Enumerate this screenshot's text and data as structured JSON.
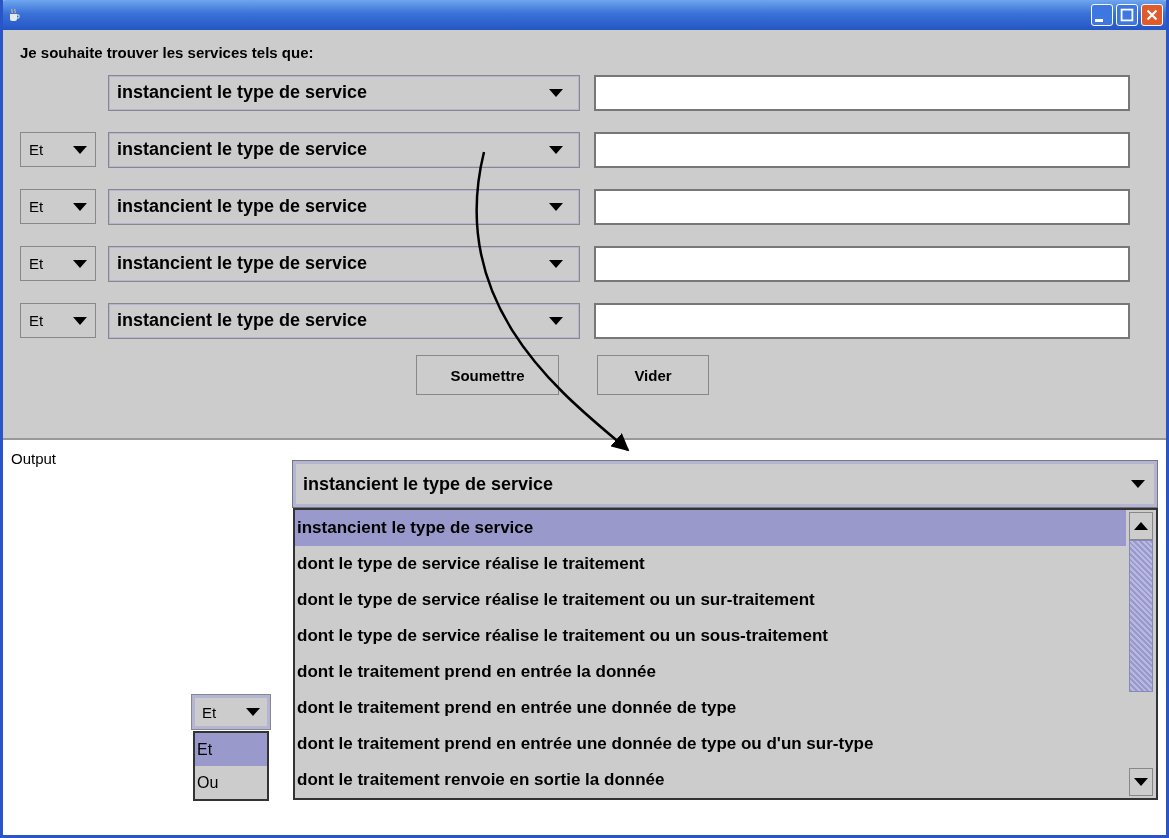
{
  "query": {
    "heading": "Je souhaite trouver les services tels que:",
    "rows": [
      {
        "criterion": "instancient le type de service"
      },
      {
        "connector": "Et",
        "criterion": "instancient le type de service"
      },
      {
        "connector": "Et",
        "criterion": "instancient le type de service"
      },
      {
        "connector": "Et",
        "criterion": "instancient le type de service"
      },
      {
        "connector": "Et",
        "criterion": "instancient le type de service"
      }
    ]
  },
  "buttons": [
    "Soumettre",
    "Vider"
  ],
  "output": {
    "label": "Output",
    "criterion_dropdown": {
      "value": "instancient le type de service",
      "options": [
        {
          "label": "instancient le type de service",
          "selected": true
        },
        {
          "label": "dont le type de service réalise le traitement",
          "selected": false
        },
        {
          "label": "dont le type de service réalise le traitement ou un sur-traitement",
          "selected": false
        },
        {
          "label": "dont le type de service réalise le traitement ou un sous-traitement",
          "selected": false
        },
        {
          "label": "dont le traitement prend en entrée la donnée",
          "selected": false
        },
        {
          "label": "dont le traitement prend en entrée une donnée de type",
          "selected": false
        },
        {
          "label": "dont le traitement prend en entrée une donnée de type ou d'un sur-type",
          "selected": false
        },
        {
          "label": "dont le traitement renvoie en sortie la donnée",
          "selected": false
        }
      ]
    },
    "connector_dropdown": {
      "value": "Et",
      "options": [
        {
          "label": "Et",
          "selected": true
        },
        {
          "label": "Ou",
          "selected": false
        }
      ]
    }
  }
}
